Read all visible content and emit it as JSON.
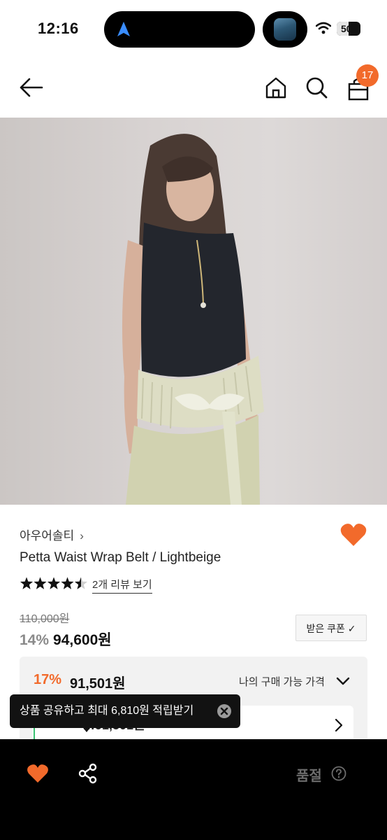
{
  "status_bar": {
    "time": "12:16",
    "battery": "50",
    "battery_level": 0.5
  },
  "header": {
    "cart_count": "17"
  },
  "product": {
    "brand": "아우어솔티",
    "brand_chevron": "›",
    "name": "Petta Waist Wrap Belt / Lightbeige",
    "rating": 4.5,
    "review_link": "2개 리뷰 보기",
    "original_price": "110,000원",
    "discount_rate": "14%",
    "sale_price": "94,600원",
    "coupon_button": "받은 쿠폰 ✓"
  },
  "best_price": {
    "discount_rate": "17%",
    "price": "91,501원",
    "label": "나의 구매 가능 가격",
    "inner_text": "…91,501원"
  },
  "toast": {
    "message": "상품 공유하고 최대 6,810원 적립받기"
  },
  "bottom_bar": {
    "status": "품절"
  },
  "colors": {
    "accent": "#f26a2b",
    "bottom_bar": "#000000"
  },
  "icons": [
    "back-arrow-icon",
    "home-icon",
    "search-icon",
    "cart-icon",
    "heart-icon",
    "star-icon",
    "chevron-down-icon",
    "chevron-right-icon",
    "close-icon",
    "share-icon",
    "help-icon"
  ]
}
